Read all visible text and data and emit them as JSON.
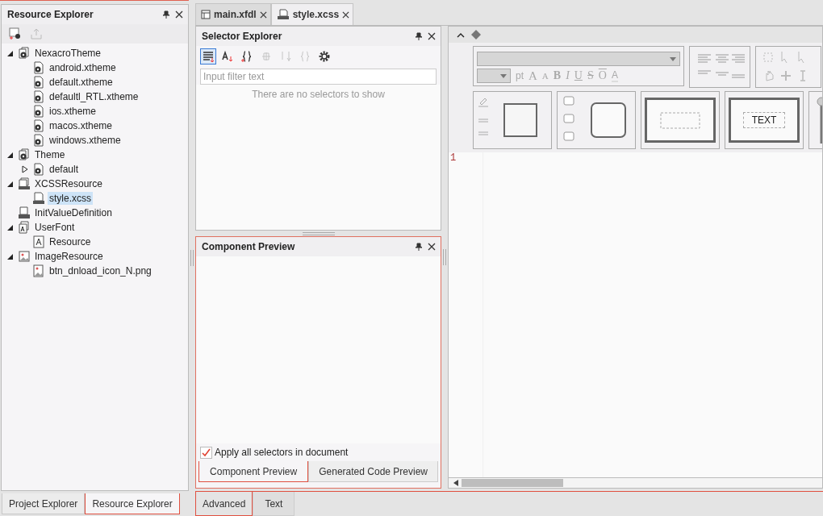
{
  "resource_explorer": {
    "title": "Resource Explorer",
    "tree": [
      {
        "label": "NexacroTheme",
        "kind": "theme-folder",
        "expanded": true,
        "selected": false,
        "children": [
          {
            "label": "android.xtheme",
            "kind": "theme-file",
            "selected": false
          },
          {
            "label": "default.xtheme",
            "kind": "theme-file",
            "selected": false
          },
          {
            "label": "defaultl_RTL.xtheme",
            "kind": "theme-file",
            "selected": false
          },
          {
            "label": "ios.xtheme",
            "kind": "theme-file",
            "selected": false
          },
          {
            "label": "macos.xtheme",
            "kind": "theme-file",
            "selected": false
          },
          {
            "label": "windows.xtheme",
            "kind": "theme-file",
            "selected": false
          }
        ]
      },
      {
        "label": "Theme",
        "kind": "theme-folder",
        "expanded": true,
        "selected": false,
        "children": [
          {
            "label": "default",
            "kind": "theme-file",
            "expanded": false,
            "selected": false
          }
        ]
      },
      {
        "label": "XCSSResource",
        "kind": "xcss-folder",
        "expanded": true,
        "selected": false,
        "children": [
          {
            "label": "style.xcss",
            "kind": "xcss-file",
            "selected": true
          }
        ]
      },
      {
        "label": "InitValueDefinition",
        "kind": "init",
        "selected": false
      },
      {
        "label": "UserFont",
        "kind": "font-folder",
        "expanded": true,
        "selected": false,
        "children": [
          {
            "label": "Resource",
            "kind": "font-file",
            "selected": false
          }
        ]
      },
      {
        "label": "ImageResource",
        "kind": "image-folder",
        "expanded": true,
        "selected": false,
        "children": [
          {
            "label": "btn_dnload_icon_N.png",
            "kind": "image-file",
            "selected": false
          }
        ]
      }
    ],
    "tabs": [
      {
        "label": "Project Explorer",
        "selected": false
      },
      {
        "label": "Resource Explorer",
        "selected": true
      }
    ]
  },
  "document_tabs": [
    {
      "label": "main.xfdl",
      "kind": "form",
      "selected": false
    },
    {
      "label": "style.xcss",
      "kind": "xcss",
      "selected": true
    }
  ],
  "selector_explorer": {
    "title": "Selector Explorer",
    "tools": [
      {
        "kind": "list",
        "selected": true,
        "disabled": false
      },
      {
        "kind": "sort",
        "selected": false,
        "disabled": false
      },
      {
        "kind": "add",
        "selected": false,
        "disabled": false
      },
      {
        "kind": "align",
        "selected": false,
        "disabled": true
      },
      {
        "kind": "down",
        "selected": false,
        "disabled": true
      },
      {
        "kind": "remove",
        "selected": false,
        "disabled": true
      },
      {
        "kind": "settings",
        "selected": false,
        "disabled": false
      }
    ],
    "filter": {
      "placeholder": "Input filter text"
    },
    "empty_message": "There are no selectors to show"
  },
  "component_preview": {
    "title": "Component Preview",
    "apply_all": {
      "label": "Apply all selectors in document",
      "checked": true
    },
    "tabs": [
      {
        "label": "Component Preview",
        "selected": true
      },
      {
        "label": "Generated Code Preview",
        "selected": false
      }
    ]
  },
  "editor": {
    "size_unit": "pt",
    "format_buttons": [
      {
        "label": "A",
        "kind": "grow"
      },
      {
        "label": "A",
        "kind": "shrink"
      },
      {
        "label": "B",
        "kind": "bold"
      },
      {
        "label": "I",
        "kind": "italic"
      },
      {
        "label": "U",
        "kind": "underline"
      },
      {
        "label": "S",
        "kind": "strike"
      },
      {
        "label": "O",
        "kind": "overline"
      },
      {
        "label": "A",
        "kind": "color"
      }
    ],
    "preview_text": "TEXT",
    "line_numbers": [
      "1"
    ],
    "tabs": [
      {
        "label": "Advanced",
        "selected": true
      },
      {
        "label": "Text",
        "selected": false
      }
    ]
  }
}
